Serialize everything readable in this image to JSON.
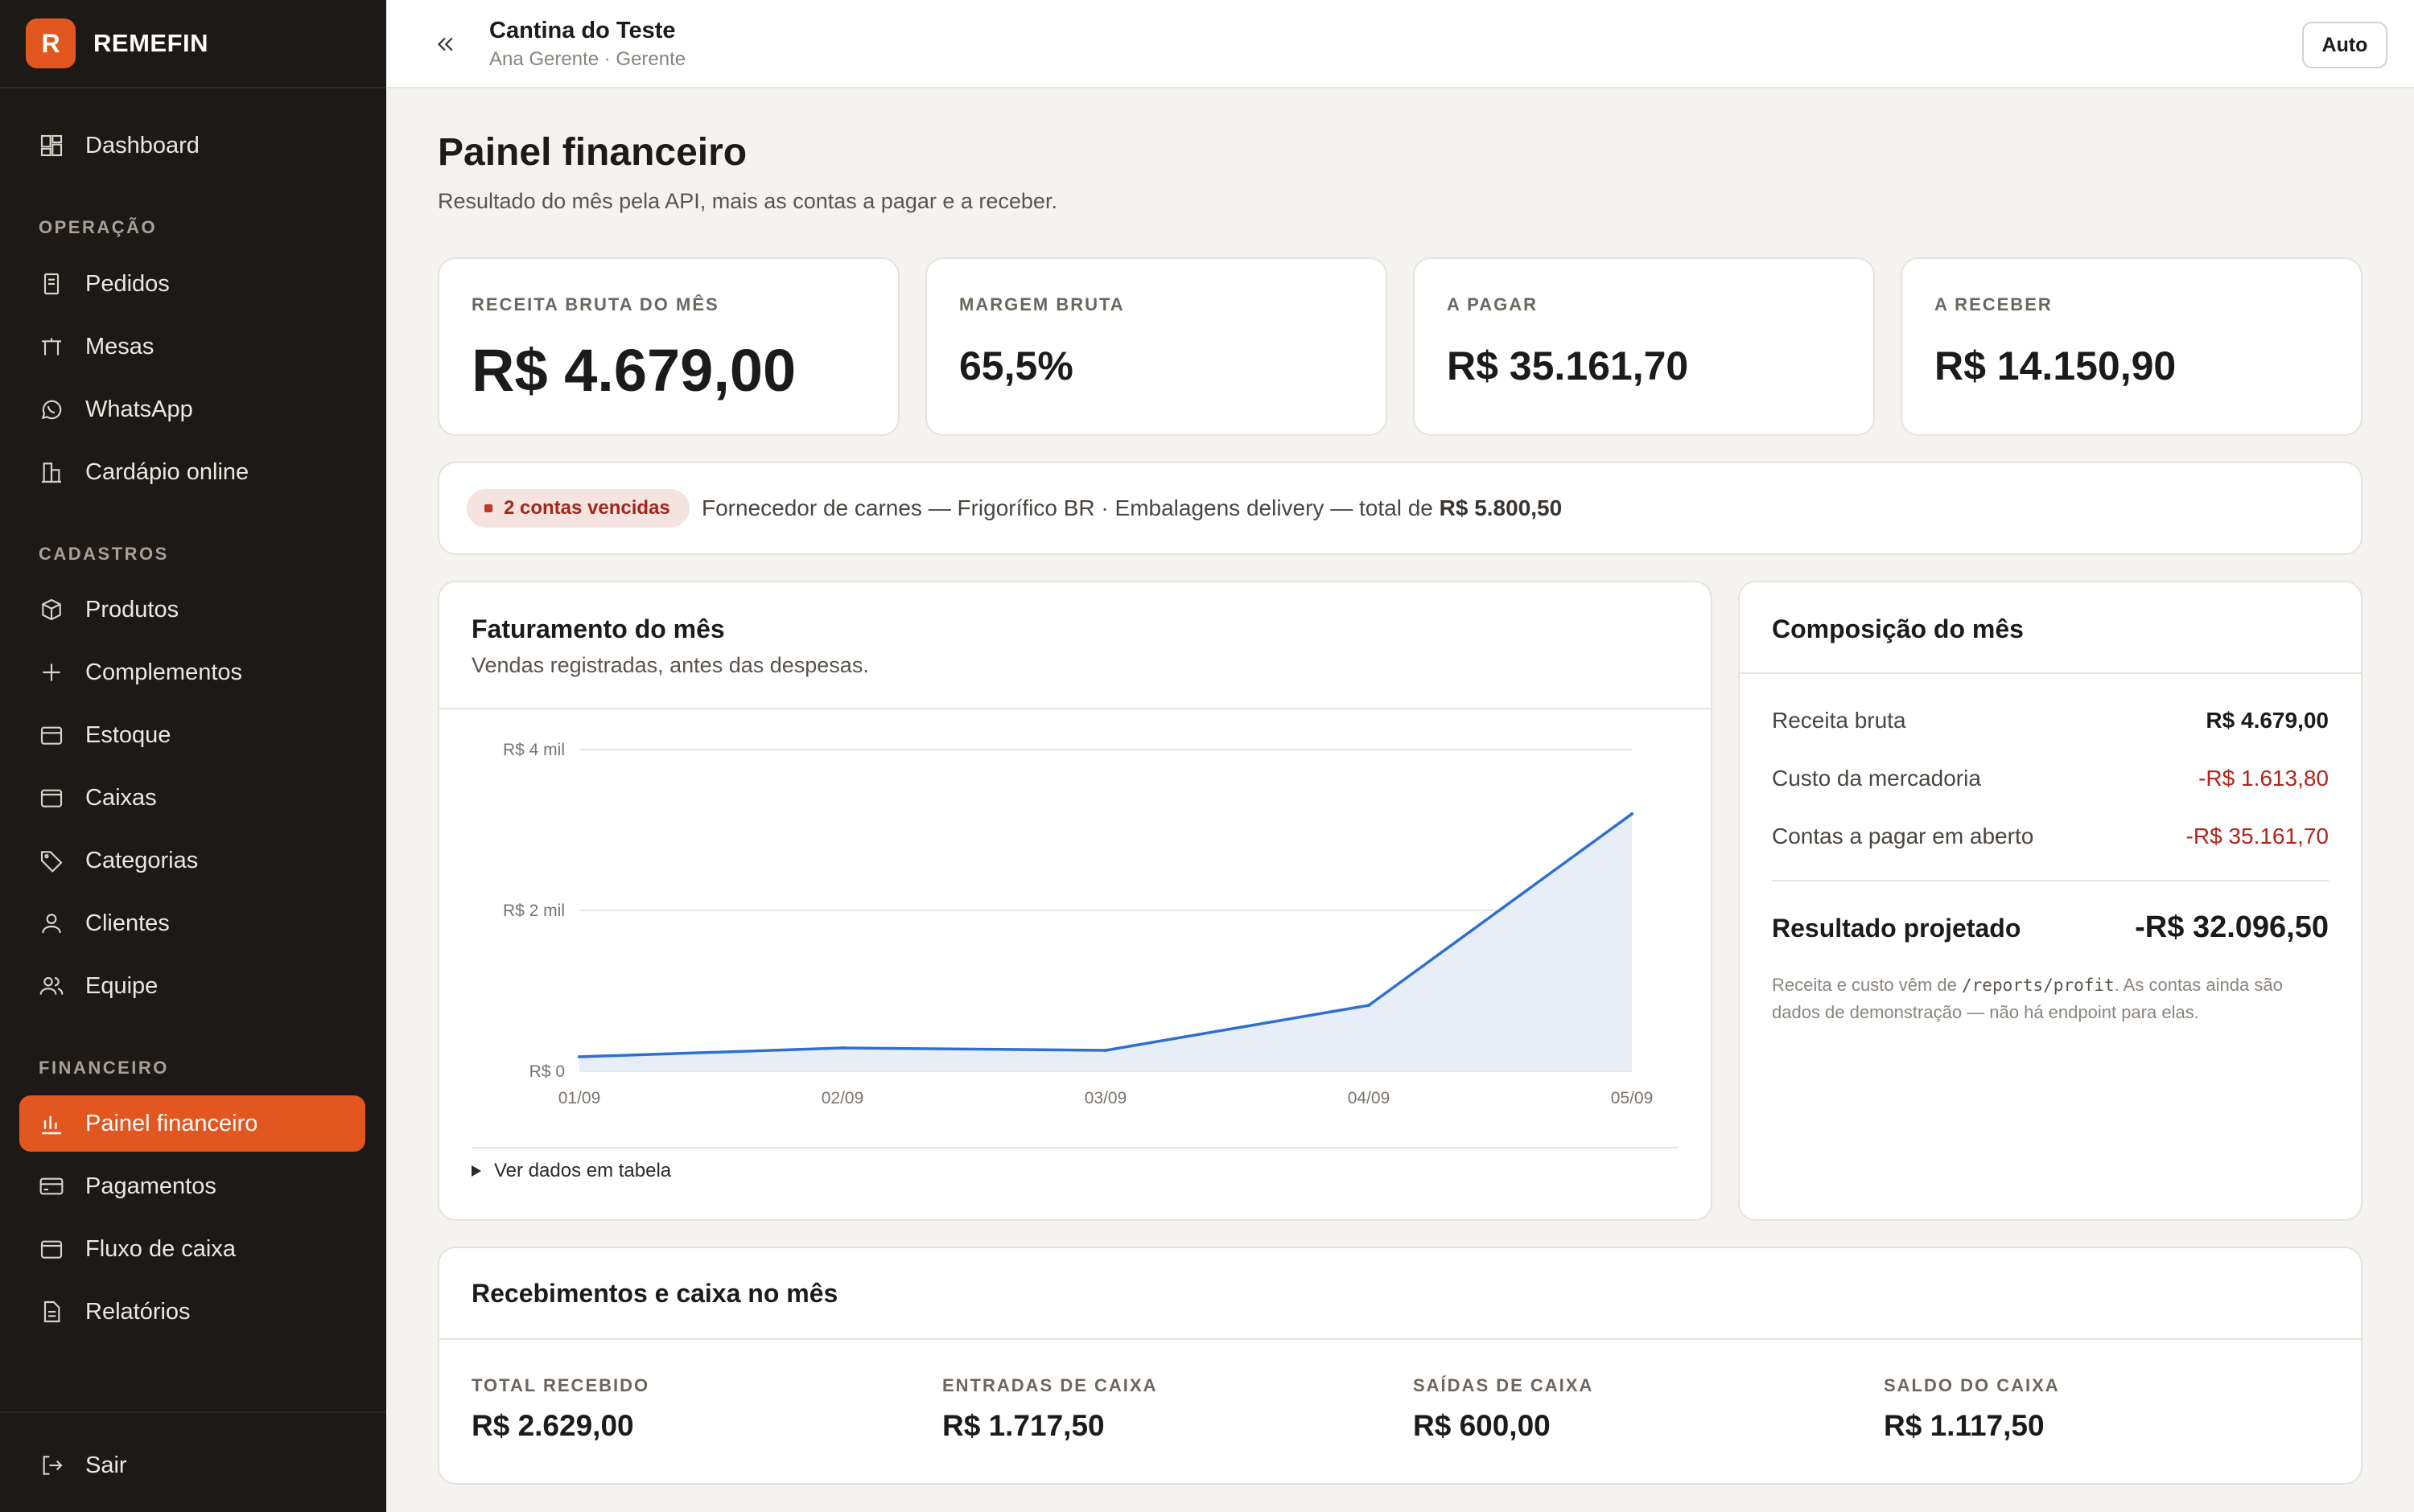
{
  "brand": {
    "logo_letter": "R",
    "name": "REMEFIN",
    "accent": "#e2571f"
  },
  "nav": {
    "dashboard": "Dashboard",
    "section_operacao": "OPERAÇÃO",
    "pedidos": "Pedidos",
    "mesas": "Mesas",
    "whatsapp": "WhatsApp",
    "cardapio": "Cardápio online",
    "section_cadastros": "CADASTROS",
    "produtos": "Produtos",
    "complementos": "Complementos",
    "estoque": "Estoque",
    "caixas": "Caixas",
    "categorias": "Categorias",
    "clientes": "Clientes",
    "equipe": "Equipe",
    "section_financeiro": "FINANCEIRO",
    "painel": "Painel financeiro",
    "pagamentos": "Pagamentos",
    "fluxo": "Fluxo de caixa",
    "relatorios": "Relatórios",
    "sair": "Sair"
  },
  "topbar": {
    "shop_name": "Cantina do Teste",
    "user": "Ana Gerente · Gerente",
    "theme_button": "Auto"
  },
  "page": {
    "title": "Painel financeiro",
    "subtitle": "Resultado do mês pela API, mais as contas a pagar e a receber."
  },
  "kpis": [
    {
      "label": "RECEITA BRUTA DO MÊS",
      "value": "R$ 4.679,00"
    },
    {
      "label": "MARGEM BRUTA",
      "value": "65,5%"
    },
    {
      "label": "A PAGAR",
      "value": "R$ 35.161,70"
    },
    {
      "label": "A RECEBER",
      "value": "R$ 14.150,90"
    }
  ],
  "alert": {
    "badge": "2 contas vencidas",
    "text": "Fornecedor de carnes — Frigorífico BR · Embalagens delivery — total de ",
    "total": "R$ 5.800,50"
  },
  "faturamento": {
    "title": "Faturamento do mês",
    "subtitle": "Vendas registradas, antes das despesas.",
    "details_label": "Ver dados em tabela"
  },
  "chart_data": {
    "type": "area",
    "title": "Faturamento do mês",
    "x": [
      "01/09",
      "02/09",
      "03/09",
      "04/09",
      "05/09"
    ],
    "y_ticks": [
      "R$ 0",
      "R$ 2 mil",
      "R$ 4 mil"
    ],
    "ylim": [
      0,
      4000
    ],
    "series": [
      {
        "values": [
          180,
          290,
          260,
          820,
          3200
        ]
      }
    ],
    "grid": true,
    "line_color": "#2f6fcf",
    "fill_color": "#e8eef8"
  },
  "composicao": {
    "title": "Composição do mês",
    "rows": [
      {
        "label": "Receita bruta",
        "value": "R$ 4.679,00"
      },
      {
        "label": "Custo da mercadoria",
        "value": "-R$ 1.613,80"
      },
      {
        "label": "Contas a pagar em aberto",
        "value": "-R$ 35.161,70"
      }
    ],
    "total_label": "Resultado projetado",
    "total_value": "-R$ 32.096,50",
    "note_before": "Receita e custo vêm de ",
    "note_code": "/reports/profit",
    "note_after": ". As contas ainda são dados de demonstração — não há endpoint para elas."
  },
  "recebimentos": {
    "title": "Recebimentos e caixa no mês",
    "stats": [
      {
        "label": "TOTAL RECEBIDO",
        "value": "R$ 2.629,00"
      },
      {
        "label": "ENTRADAS DE CAIXA",
        "value": "R$ 1.717,50"
      },
      {
        "label": "SAÍDAS DE CAIXA",
        "value": "R$ 600,00"
      },
      {
        "label": "SALDO DO CAIXA",
        "value": "R$ 1.117,50"
      }
    ]
  }
}
